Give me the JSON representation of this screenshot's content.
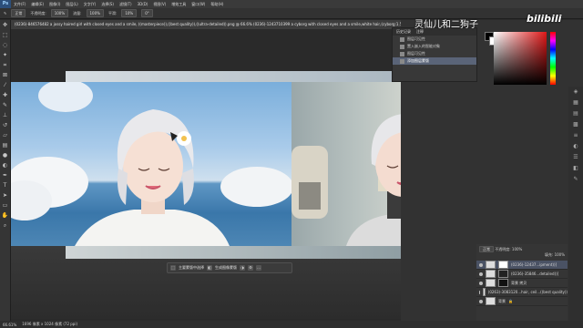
{
  "menu": {
    "logo": "Ps",
    "items": [
      "文件(F)",
      "编辑(E)",
      "图像(I)",
      "图层(L)",
      "文字(Y)",
      "选择(S)",
      "滤镜(T)",
      "3D(D)",
      "视图(V)",
      "增效工具",
      "窗口(W)",
      "帮助(H)"
    ]
  },
  "options": {
    "mode_label": "正常",
    "opacity_label": "不透明度:",
    "opacity": "100%",
    "flow_label": "流量:",
    "flow": "100%",
    "smooth_label": "平滑:",
    "smooth": "10%",
    "angle": "0°"
  },
  "doc_tab": "(0236)-846576482 a jossy haired girl with closed eyes and a smile, ((masterpiece)),((best quality)),((ultra-detailed)).png @ 66.6% (0236)-1243710399 a cyborg with closed eyes and a smile,white hair,(cyborg:1.5),mecha,robot,mmmmechanical,equipment,film still, ((masterpiece))...",
  "toolbar_icons": [
    "move-icon",
    "marquee-icon",
    "lasso-icon",
    "quick-select-icon",
    "crop-icon",
    "frame-icon",
    "eyedropper-icon",
    "heal-icon",
    "brush-icon",
    "stamp-icon",
    "history-brush-icon",
    "eraser-icon",
    "gradient-icon",
    "blur-icon",
    "dodge-icon",
    "pen-icon",
    "type-icon",
    "path-select-icon",
    "shape-icon",
    "hand-icon",
    "zoom-icon"
  ],
  "history": {
    "tab1": "历史记录",
    "tab2": "注释",
    "items": [
      "图层可见性",
      "置入嵌入的智能对象",
      "图层可见性",
      "添加图层蒙版"
    ]
  },
  "watermark": "灵仙儿和二狗子",
  "bilibili": "bilibili",
  "context_bar": {
    "btn1": "主要蒙版中选择",
    "btn2": "生成图像蒙版"
  },
  "layers": {
    "blend": "正常",
    "opacity_label": "不透明度:",
    "opacity": "100%",
    "fill_label": "填充:",
    "fill": "100%",
    "rows": [
      {
        "name": "(0236)-12437...ipment))]"
      },
      {
        "name": "(0236)-35846...detailed))]"
      },
      {
        "name": "背景 拷贝"
      },
      {
        "name": "(0263)-3083120...hair, ceil...((best quality))"
      },
      {
        "name": "背景"
      }
    ]
  },
  "status": {
    "zoom": "66.61%",
    "size": "1696 像素 x 1024 像素 (72 ppi)"
  }
}
